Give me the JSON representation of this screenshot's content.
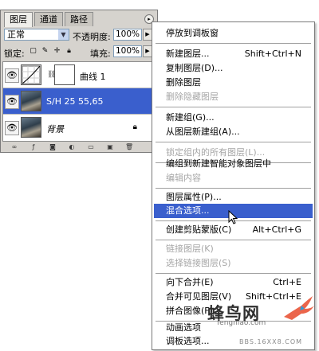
{
  "panel": {
    "tabs": [
      "图层",
      "通道",
      "路径"
    ],
    "blend_mode": "正常",
    "opacity_label": "不透明度:",
    "opacity_value": "100%",
    "lock_label": "锁定:",
    "fill_label": "填充:",
    "fill_value": "100%",
    "layers": [
      {
        "name": "曲线 1",
        "visible": true,
        "selected": false,
        "type": "adjustment-curves"
      },
      {
        "name": "S/H 25 55,65",
        "visible": true,
        "selected": true,
        "type": "image"
      },
      {
        "name": "背景",
        "visible": true,
        "selected": false,
        "type": "background",
        "locked": true
      }
    ]
  },
  "menu": {
    "items": [
      {
        "label": "停放到调板窗",
        "shortcut": "",
        "enabled": true
      },
      {
        "label": "新建图层...",
        "shortcut": "Shift+Ctrl+N",
        "enabled": true
      },
      {
        "label": "复制图层(D)...",
        "shortcut": "",
        "enabled": true
      },
      {
        "label": "删除图层",
        "shortcut": "",
        "enabled": true
      },
      {
        "label": "删除隐藏图层",
        "shortcut": "",
        "enabled": false
      },
      {
        "label": "新建组(G)...",
        "shortcut": "",
        "enabled": true
      },
      {
        "label": "从图层新建组(A)...",
        "shortcut": "",
        "enabled": true
      },
      {
        "label": "锁定组内的所有图层(L)...",
        "shortcut": "",
        "enabled": false
      },
      {
        "label": "编组到新建智能对象图层中",
        "shortcut": "",
        "enabled": true
      },
      {
        "label": "编辑内容",
        "shortcut": "",
        "enabled": false
      },
      {
        "label": "图层属性(P)...",
        "shortcut": "",
        "enabled": true
      },
      {
        "label": "混合选项...",
        "shortcut": "",
        "enabled": true,
        "highlighted": true
      },
      {
        "label": "创建剪贴蒙版(C)",
        "shortcut": "Alt+Ctrl+G",
        "enabled": true
      },
      {
        "label": "链接图层(K)",
        "shortcut": "",
        "enabled": false
      },
      {
        "label": "选择链接图层(S)",
        "shortcut": "",
        "enabled": false
      },
      {
        "label": "向下合并(E)",
        "shortcut": "Ctrl+E",
        "enabled": true
      },
      {
        "label": "合并可见图层(V)",
        "shortcut": "Shift+Ctrl+E",
        "enabled": true
      },
      {
        "label": "拼合图像(F)",
        "shortcut": "",
        "enabled": true
      },
      {
        "label": "动画选项",
        "shortcut": "",
        "enabled": true
      },
      {
        "label": "调板选项...",
        "shortcut": "",
        "enabled": true
      }
    ]
  },
  "watermark": {
    "title": "蜂鸟网",
    "sub": "fengniao.com",
    "sub2": "BBS.16XX8.COM"
  },
  "colors": {
    "selection": "#3a5fcd",
    "panel_bg": "#d6d3ce",
    "disabled_text": "#a6a6a6"
  }
}
